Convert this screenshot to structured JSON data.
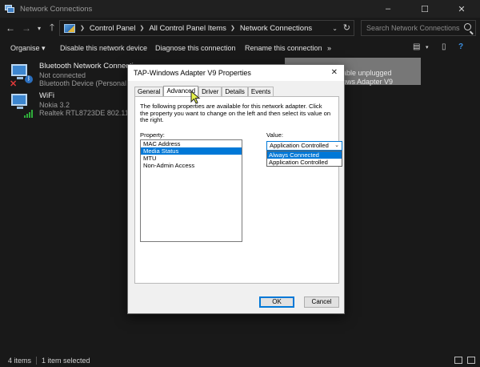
{
  "window": {
    "title": "Network Connections",
    "controls": {
      "minimize": "–",
      "maximize": "☐",
      "close": "✕"
    }
  },
  "address": {
    "breadcrumbs": [
      "Control Panel",
      "All Control Panel Items",
      "Network Connections"
    ],
    "search_placeholder": "Search Network Connections"
  },
  "toolbar": {
    "items": [
      "Organise ▾",
      "Disable this network device",
      "Diagnose this connection",
      "Rename this connection",
      "»"
    ]
  },
  "connections": [
    {
      "name": "Bluetooth Network Connection",
      "status": "Not connected",
      "device": "Bluetooth Device (Personal Area ...",
      "icon": "bluetooth-network-icon"
    },
    {
      "name": "WiFi",
      "status": "Nokia 3.2",
      "device": "Realtek RTL8723DE 802.11b/g/n ...",
      "icon": "wifi-network-icon"
    }
  ],
  "selected_connection": {
    "status": "able unplugged",
    "device": "ows Adapter V9"
  },
  "statusbar": {
    "items_count": "4 items",
    "selected": "1 item selected"
  },
  "dialog": {
    "title": "TAP-Windows Adapter V9 Properties",
    "tabs": [
      "General",
      "Advanced",
      "Driver",
      "Details",
      "Events"
    ],
    "active_tab": "Advanced",
    "description": "The following properties are available for this network adapter. Click the property you want to change on the left and then select its value on the right.",
    "property_label": "Property:",
    "value_label": "Value:",
    "properties": [
      "MAC Address",
      "Media Status",
      "MTU",
      "Non-Admin Access"
    ],
    "selected_property": "Media Status",
    "combo_value": "Application Controlled",
    "dropdown_options": [
      "Always Connected",
      "Application Controlled"
    ],
    "highlighted_option": "Always Connected",
    "ok_label": "OK",
    "cancel_label": "Cancel"
  }
}
